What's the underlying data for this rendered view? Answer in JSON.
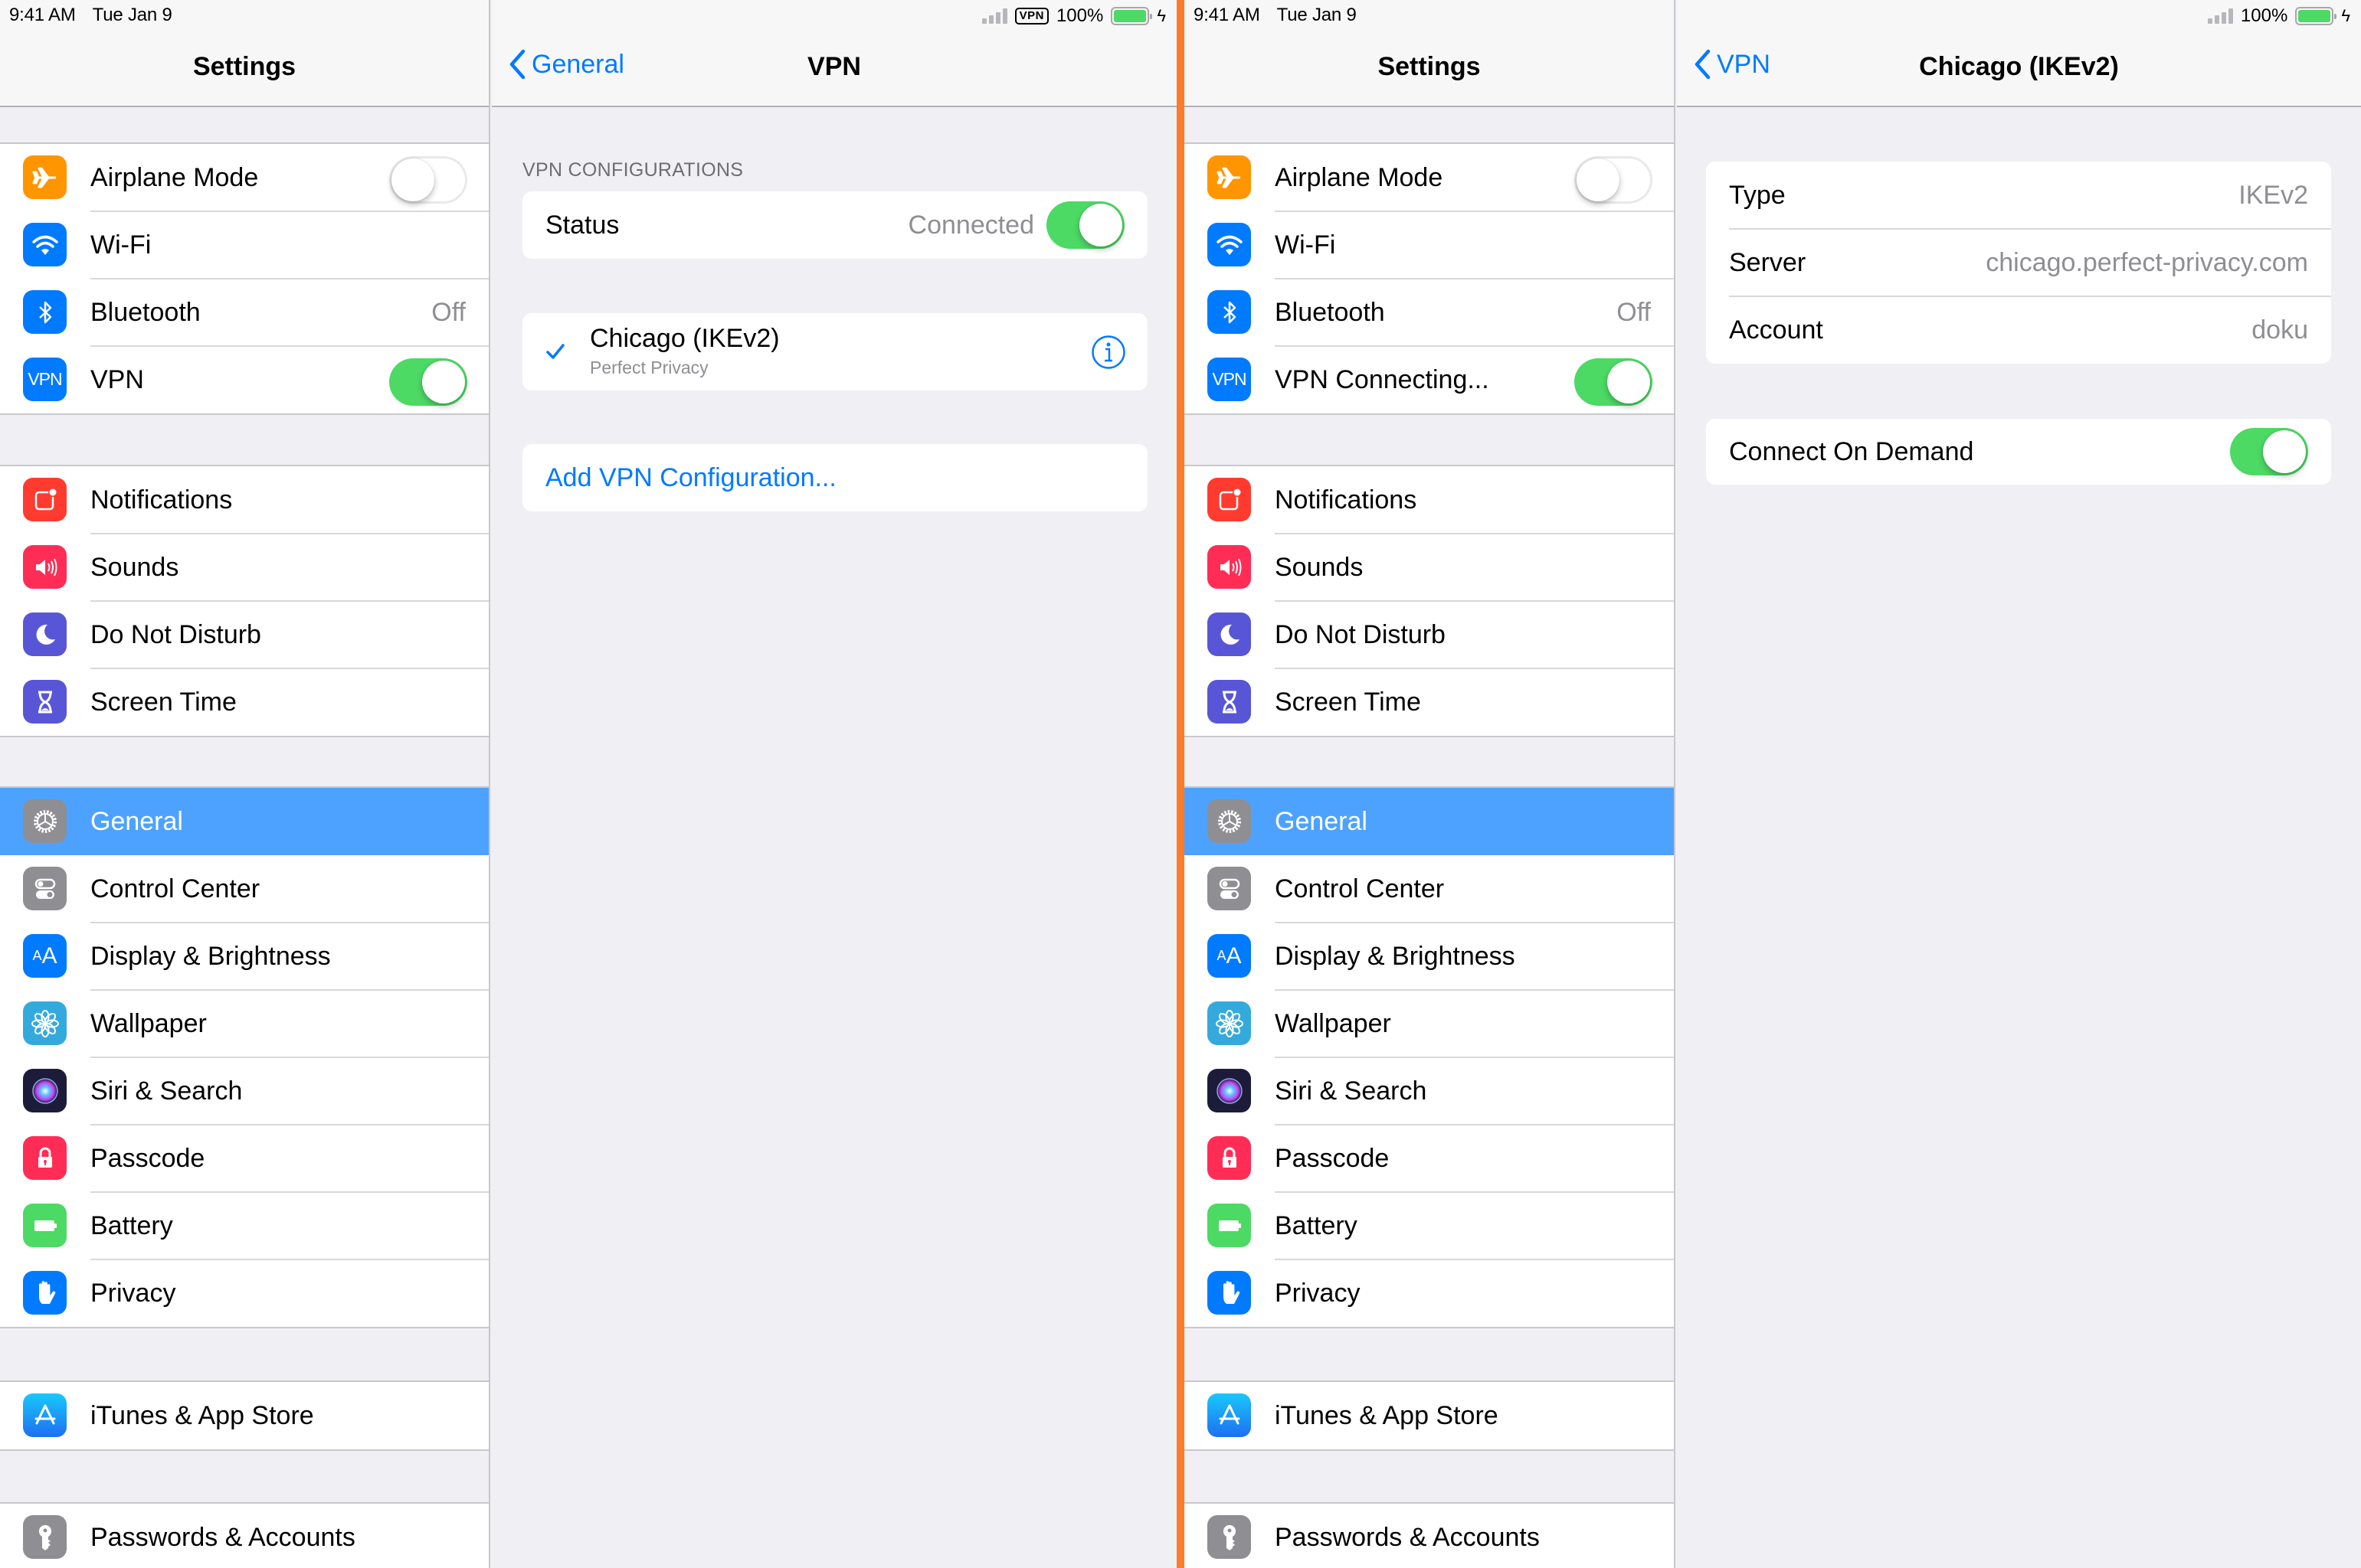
{
  "status_bar": {
    "time": "9:41 AM",
    "date": "Tue Jan 9",
    "vpn_indicator": "VPN",
    "battery_percent": "100%",
    "battery_level": 1.0,
    "charging": true
  },
  "colors": {
    "accent": "#007aff",
    "toggle_on": "#4cd964",
    "selected_row": "#4da2ff",
    "divider": "#fb7c2a",
    "background": "#efeff4"
  },
  "left_screen": {
    "master": {
      "title": "Settings",
      "groups": [
        [
          {
            "label": "Airplane Mode",
            "icon": "airplane-icon",
            "color": "#ff9500",
            "toggle": false
          },
          {
            "label": "Wi-Fi",
            "icon": "wifi-icon",
            "color": "#007aff"
          },
          {
            "label": "Bluetooth",
            "icon": "bluetooth-icon",
            "color": "#007aff",
            "value": "Off"
          },
          {
            "label": "VPN",
            "icon": "vpn-icon",
            "color": "#007aff",
            "toggle": true
          }
        ],
        [
          {
            "label": "Notifications",
            "icon": "notifications-icon",
            "color": "#ff3b30"
          },
          {
            "label": "Sounds",
            "icon": "sounds-icon",
            "color": "#ff2d55"
          },
          {
            "label": "Do Not Disturb",
            "icon": "moon-icon",
            "color": "#5856d6"
          },
          {
            "label": "Screen Time",
            "icon": "hourglass-icon",
            "color": "#5856d6"
          }
        ],
        [
          {
            "label": "General",
            "icon": "gear-icon",
            "color": "#8e8e93",
            "selected": true
          },
          {
            "label": "Control Center",
            "icon": "control-center-icon",
            "color": "#8e8e93"
          },
          {
            "label": "Display & Brightness",
            "icon": "display-icon",
            "color": "#007aff"
          },
          {
            "label": "Wallpaper",
            "icon": "wallpaper-icon",
            "color": "#34aadc"
          },
          {
            "label": "Siri & Search",
            "icon": "siri-icon",
            "color": "#1c1c3a"
          },
          {
            "label": "Passcode",
            "icon": "lock-icon",
            "color": "#ff2d55"
          },
          {
            "label": "Battery",
            "icon": "battery-icon",
            "color": "#4cd964"
          },
          {
            "label": "Privacy",
            "icon": "hand-icon",
            "color": "#007aff"
          }
        ],
        [
          {
            "label": "iTunes & App Store",
            "icon": "app-store-icon",
            "color": "#1a8cff"
          }
        ],
        [
          {
            "label": "Passwords & Accounts",
            "icon": "key-icon",
            "color": "#8e8e93"
          }
        ]
      ]
    },
    "detail": {
      "back_label": "General",
      "title": "VPN",
      "section_header": "VPN CONFIGURATIONS",
      "status_label": "Status",
      "status_value": "Connected",
      "status_toggle": true,
      "config_name": "Chicago (IKEv2)",
      "config_provider": "Perfect Privacy",
      "add_config_label": "Add VPN Configuration..."
    }
  },
  "right_screen": {
    "master": {
      "title": "Settings",
      "vpn_label": "VPN Connecting..."
    },
    "detail": {
      "back_label": "VPN",
      "title": "Chicago (IKEv2)",
      "fields": [
        {
          "label": "Type",
          "value": "IKEv2"
        },
        {
          "label": "Server",
          "value": "chicago.perfect-privacy.com"
        },
        {
          "label": "Account",
          "value": "doku"
        }
      ],
      "connect_on_demand_label": "Connect On Demand",
      "connect_on_demand": true
    }
  }
}
